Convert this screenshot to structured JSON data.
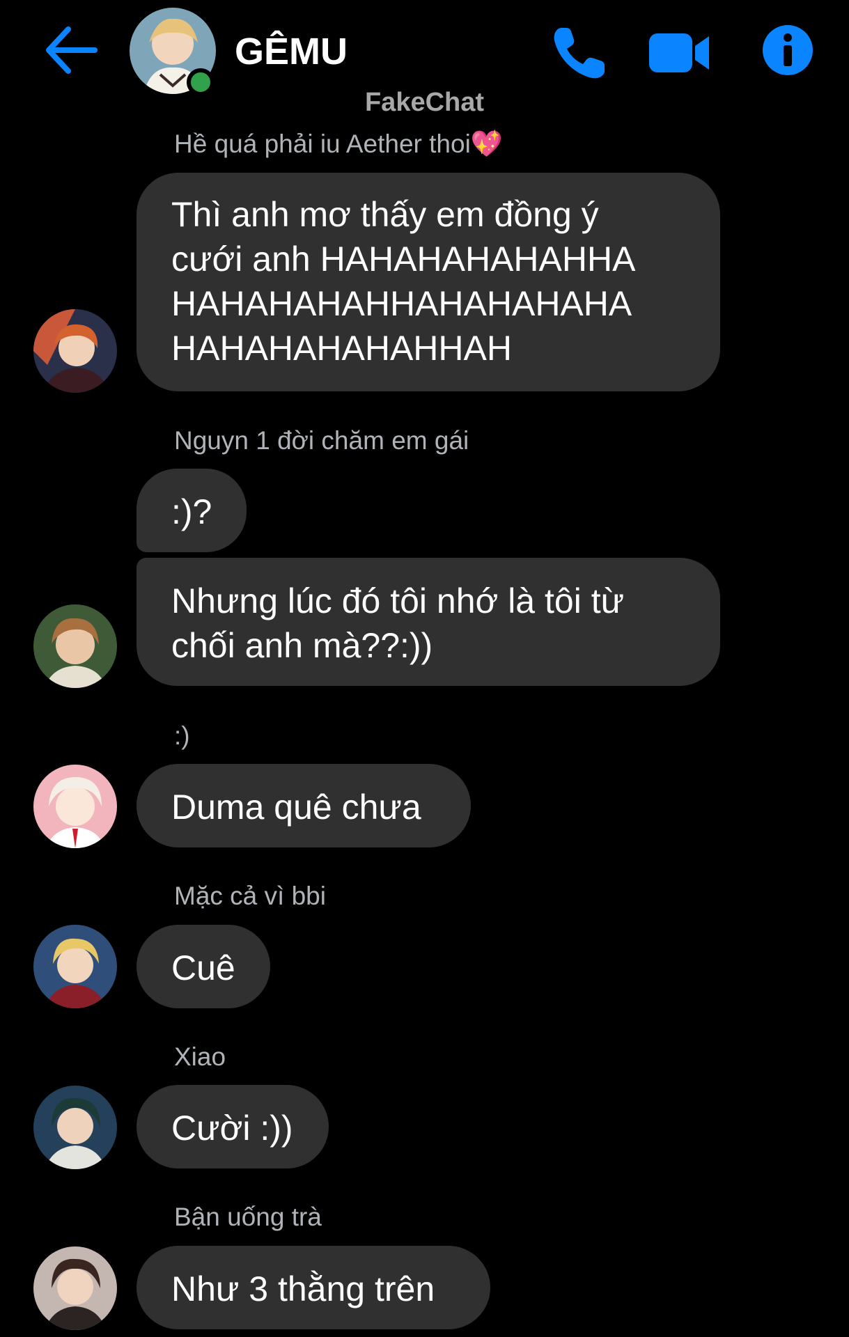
{
  "header": {
    "back_icon": "arrow-left-icon",
    "title": "GÊMU",
    "online_status": "online",
    "phone_icon": "phone-icon",
    "video_icon": "video-camera-icon",
    "info_icon": "info-icon",
    "watermark": "FakeChat"
  },
  "colors": {
    "accent": "#0a84ff",
    "online": "#31a24c",
    "bubble": "#303030",
    "background": "#000000",
    "sender_name": "#b0b3b8"
  },
  "messages": [
    {
      "sender": "Hề quá phải iu Aether thoi💖",
      "bubbles": [
        "Thì anh mơ thấy em đồng ý\ncưới anh HAHAHAHAHAHHA\nHAHAHAHAHHAHAHAHAHA\nHAHAHAHAHAHHAH"
      ]
    },
    {
      "sender": "Nguyn 1 đời chăm em gái",
      "bubbles": [
        ":)?",
        "Nhưng lúc đó tôi nhớ là tôi từ\nchối anh mà??:))"
      ]
    },
    {
      "sender": ":)",
      "bubbles": [
        "Duma quê chưa"
      ]
    },
    {
      "sender": "Mặc cả vì bbi",
      "bubbles": [
        "Cuê"
      ]
    },
    {
      "sender": "Xiao",
      "bubbles": [
        "Cười :))"
      ]
    },
    {
      "sender": "Bận uống trà",
      "bubbles": [
        "Như 3 thằng trên"
      ]
    }
  ]
}
